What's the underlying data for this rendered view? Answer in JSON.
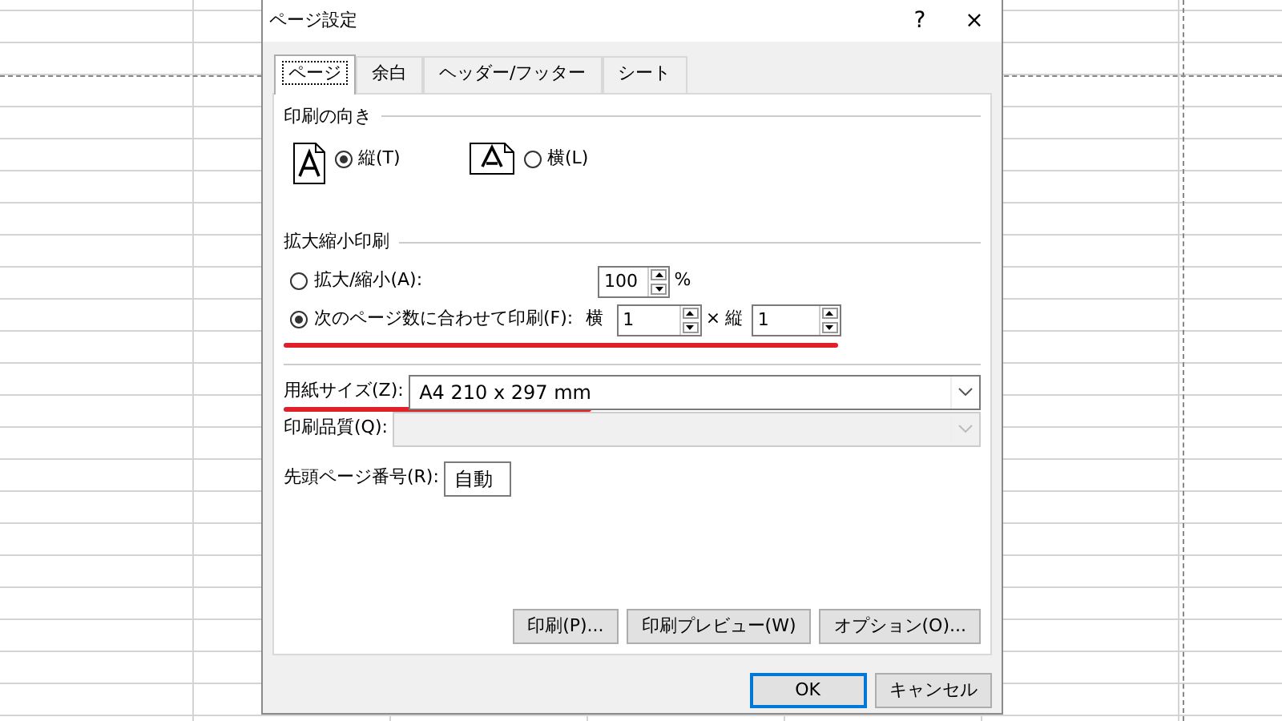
{
  "window": {
    "title": "ページ設定",
    "help": "?",
    "close": "×"
  },
  "tabs": [
    {
      "label": "ページ",
      "selected": true
    },
    {
      "label": "余白",
      "selected": false
    },
    {
      "label": "ヘッダー/フッター",
      "selected": false
    },
    {
      "label": "シート",
      "selected": false
    }
  ],
  "orientation": {
    "heading": "印刷の向き",
    "options": [
      {
        "kind": "portrait",
        "label": "縦(T)",
        "selected": true
      },
      {
        "kind": "landscape",
        "label": "横(L)",
        "selected": false
      }
    ]
  },
  "scaling": {
    "heading": "拡大縮小印刷",
    "options": [
      {
        "kind": "percent",
        "label": "拡大/縮小(A):",
        "selected": false,
        "value": "100",
        "unit": "%"
      },
      {
        "kind": "fit",
        "label": "次のページ数に合わせて印刷(F):",
        "selected": true,
        "wide_label": "横",
        "wide": "1",
        "times": "×",
        "tall_label": "縦",
        "tall": "1",
        "highlighted": true
      }
    ]
  },
  "paper_size": {
    "label": "用紙サイズ(Z):",
    "value": "A4 210 x 297 mm",
    "disabled": false,
    "highlighted": true
  },
  "print_quality": {
    "label": "印刷品質(Q):",
    "disabled": true
  },
  "first_page_number": {
    "label": "先頭ページ番号(R):",
    "value": "自動"
  },
  "action_buttons": [
    "印刷(P)...",
    "印刷プレビュー(W)",
    "オプション(O)..."
  ],
  "dialog_buttons": [
    {
      "label": "OK",
      "default": true
    },
    {
      "label": "キャンセル",
      "default": false
    }
  ]
}
